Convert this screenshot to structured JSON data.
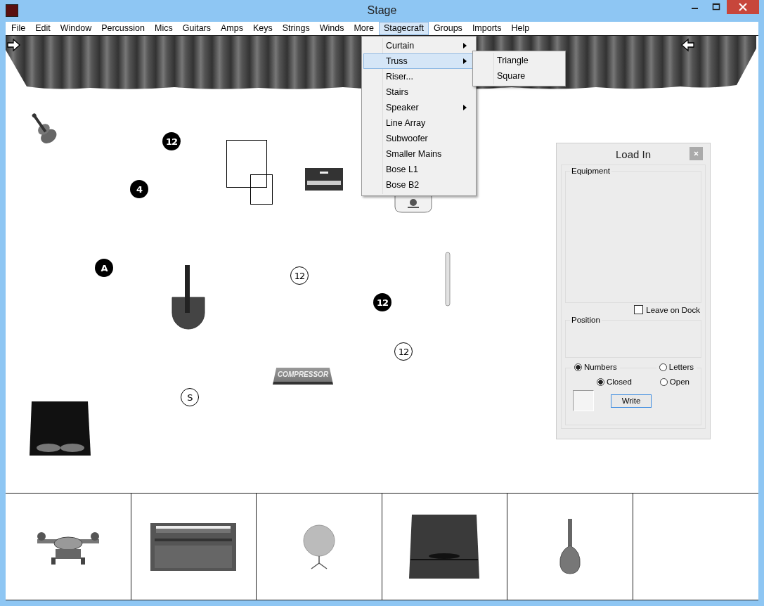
{
  "window": {
    "title": "Stage"
  },
  "menu_bar": [
    {
      "label": "File",
      "selected": false
    },
    {
      "label": "Edit",
      "selected": false
    },
    {
      "label": "Window",
      "selected": false
    },
    {
      "label": "Percussion",
      "selected": false
    },
    {
      "label": "Mics",
      "selected": false
    },
    {
      "label": "Guitars",
      "selected": false
    },
    {
      "label": "Amps",
      "selected": false
    },
    {
      "label": "Keys",
      "selected": false
    },
    {
      "label": "Strings",
      "selected": false
    },
    {
      "label": "Winds",
      "selected": false
    },
    {
      "label": "More",
      "selected": false
    },
    {
      "label": "Stagecraft",
      "selected": true
    },
    {
      "label": "Groups",
      "selected": false
    },
    {
      "label": "Imports",
      "selected": false
    },
    {
      "label": "Help",
      "selected": false
    }
  ],
  "stagecraft_menu": [
    {
      "label": "Curtain",
      "submenu": true,
      "selected": false
    },
    {
      "label": "Truss",
      "submenu": true,
      "selected": true
    },
    {
      "label": "Riser...",
      "submenu": false,
      "selected": false
    },
    {
      "label": "Stairs",
      "submenu": false,
      "selected": false
    },
    {
      "label": "Speaker",
      "submenu": true,
      "selected": false
    },
    {
      "label": "Line Array",
      "submenu": false,
      "selected": false
    },
    {
      "label": "Subwoofer",
      "submenu": false,
      "selected": false
    },
    {
      "label": "Smaller Mains",
      "submenu": false,
      "selected": false
    },
    {
      "label": "Bose L1",
      "submenu": false,
      "selected": false
    },
    {
      "label": "Bose B2",
      "submenu": false,
      "selected": false
    }
  ],
  "truss_submenu": [
    {
      "label": "Triangle"
    },
    {
      "label": "Square"
    }
  ],
  "stage_markers": [
    {
      "label": "12",
      "kind": "filled"
    },
    {
      "label": "4",
      "kind": "filled"
    },
    {
      "label": "A",
      "kind": "filled"
    },
    {
      "label": "12",
      "kind": "outline"
    },
    {
      "label": "12",
      "kind": "filled"
    },
    {
      "label": "12",
      "kind": "outline"
    },
    {
      "label": "S",
      "kind": "outline"
    }
  ],
  "compressor_label": "COMPRESSOR",
  "load_in": {
    "title": "Load In",
    "equipment_label": "Equipment",
    "leave_on_dock": {
      "label": "Leave on Dock",
      "checked": false
    },
    "position_label": "Position",
    "numbering": [
      {
        "label": "Numbers",
        "selected": true
      },
      {
        "label": "Letters",
        "selected": false
      }
    ],
    "style": [
      {
        "label": "Closed",
        "selected": true
      },
      {
        "label": "Open",
        "selected": false
      }
    ],
    "write_button": "Write"
  }
}
